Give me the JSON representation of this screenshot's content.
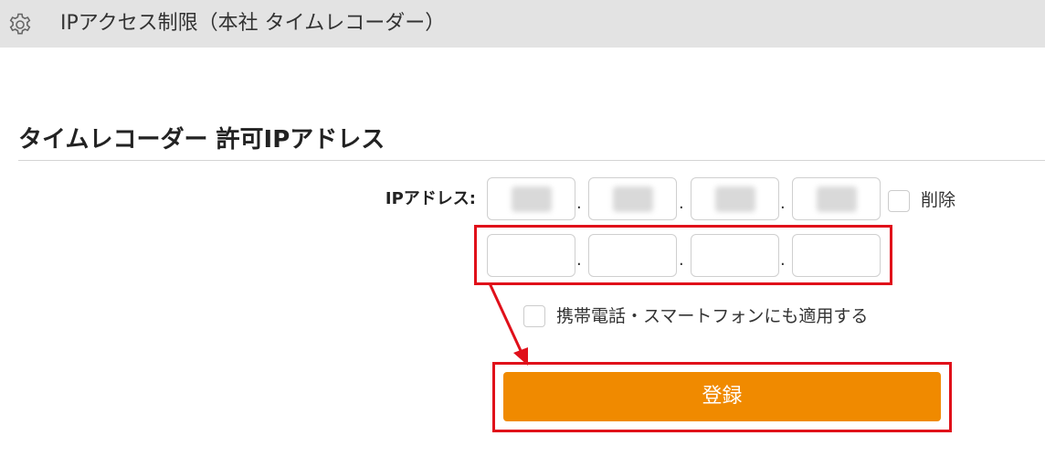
{
  "header": {
    "title": "IPアクセス制限（本社 タイムレコーダー）",
    "icon": "gear-icon"
  },
  "section": {
    "title": "タイムレコーダー 許可IPアドレス"
  },
  "form": {
    "ip_label": "IPアドレス:",
    "separator": ".",
    "delete_label": "削除",
    "mobile_label": "携帯電話・スマートフォンにも適用する",
    "submit_label": "登録"
  },
  "annotation": {
    "highlight_color": "#e0101a",
    "button_color": "#f08a00"
  }
}
